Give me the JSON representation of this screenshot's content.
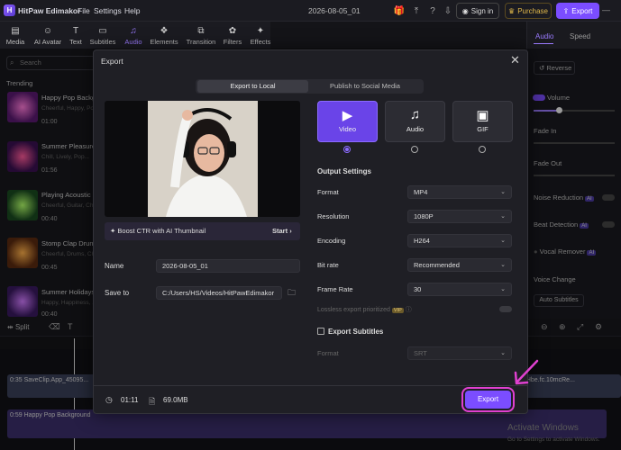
{
  "app": {
    "name": "HitPaw Edimakor",
    "menu": [
      "File",
      "Settings",
      "Help"
    ],
    "project_title": "2026-08-05_01",
    "sign_in": "Sign in",
    "purchase": "Purchase",
    "export": "Export"
  },
  "toolbar": {
    "items": [
      "Media",
      "AI Avatar",
      "Text",
      "Subtitles",
      "Audio",
      "Elements",
      "Transition",
      "Filters",
      "Effects"
    ],
    "active": "Audio"
  },
  "left_panel": {
    "search_placeholder": "Search",
    "section": "Trending",
    "tracks": [
      {
        "name": "Happy Pop Backgr...",
        "sub": "Cheerful, Happy, Po...",
        "duration": "01:00"
      },
      {
        "name": "Summer Pleasure",
        "sub": "Chill, Lively, Pop...",
        "duration": "01:56"
      },
      {
        "name": "Playing Acoustic G...",
        "sub": "Cheerful, Guitar, Ch...",
        "duration": "00:40"
      },
      {
        "name": "Stomp Clap Drum...",
        "sub": "Cheerful, Drums, Ch...",
        "duration": "00:45"
      },
      {
        "name": "Summer Holidays",
        "sub": "Happy, Happiness, ...",
        "duration": "00:40"
      }
    ]
  },
  "right_panel": {
    "tabs": [
      "Audio",
      "Speed"
    ],
    "active_tab": "Audio",
    "reverse": "Reverse",
    "volume": "Volume",
    "fade_in": "Fade In",
    "fade_out": "Fade Out",
    "noise_reduction": "Noise Reduction",
    "beat_detection": "Beat Detection",
    "vocal_remover": "Vocal Remover",
    "voice_change": "Voice Change",
    "auto_subtitles": "Auto Subtitles",
    "ai_badge": "AI"
  },
  "timeline": {
    "split": "Split",
    "video_clip_left": "0:35 SaveClip.App_45095...",
    "video_clip_right": "FV7Hbe.fc.10mcRe...",
    "audio_clip": "0:59 Happy Pop Background"
  },
  "watermark": {
    "line1": "Activate Windows",
    "line2": "Go to Settings to activate Windows."
  },
  "modal": {
    "title": "Export",
    "tabs": [
      "Export to Local",
      "Publish to Social Media"
    ],
    "active_tab": "Export to Local",
    "boost_text": "Boost CTR with AI Thumbnail",
    "boost_start": "Start",
    "name_label": "Name",
    "name_value": "2026-08-05_01",
    "save_to_label": "Save to",
    "save_to_value": "C:/Users/HS/Videos/HitPawEdimakor",
    "types": [
      {
        "label": "Video",
        "selected": true
      },
      {
        "label": "Audio",
        "selected": false
      },
      {
        "label": "GIF",
        "selected": false
      }
    ],
    "output_settings": "Output Settings",
    "settings": [
      {
        "label": "Format",
        "value": "MP4"
      },
      {
        "label": "Resolution",
        "value": "1080P"
      },
      {
        "label": "Encoding",
        "value": "H264"
      },
      {
        "label": "Bit rate",
        "value": "Recommended"
      },
      {
        "label": "Frame Rate",
        "value": "30"
      }
    ],
    "lossless": "Lossless export prioritized",
    "vip": "VIP",
    "export_subtitles": "Export Subtitles",
    "subtitle_format_label": "Format",
    "subtitle_format_value": "SRT",
    "duration": "01:11",
    "file_size": "69.0MB",
    "export_button": "Export"
  },
  "colors": {
    "accent": "#7b4dff",
    "highlight": "#e040d0"
  }
}
